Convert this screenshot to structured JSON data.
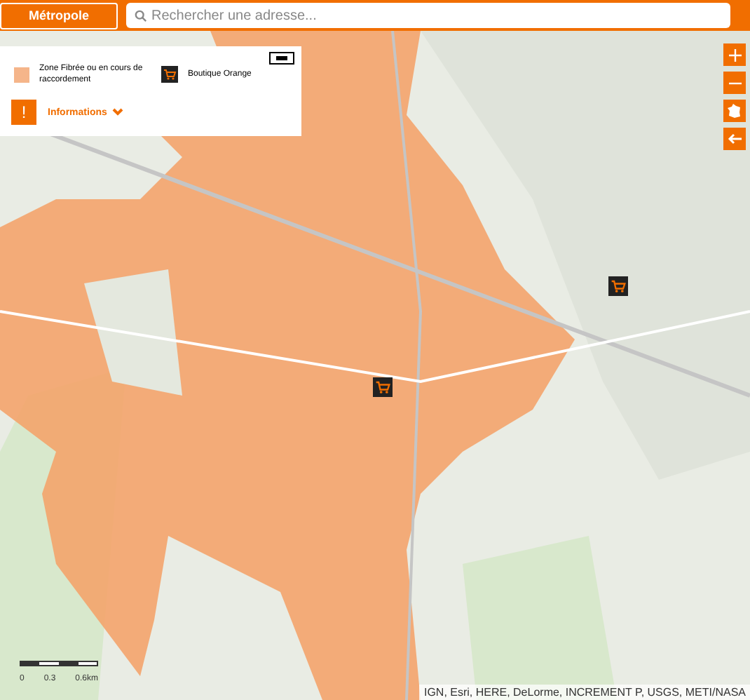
{
  "header": {
    "region_button": "Métropole",
    "search": {
      "placeholder": "Rechercher une adresse..."
    }
  },
  "legend": {
    "items": [
      {
        "kind": "swatch",
        "label": "Zone Fibrée ou en cours de raccordement",
        "color": "#f5b58a"
      },
      {
        "kind": "shop",
        "label": "Boutique Orange"
      }
    ],
    "info": {
      "icon": "!",
      "label": "Informations"
    }
  },
  "scale": {
    "ticks": [
      "0",
      "0.3",
      "0.6km"
    ]
  },
  "attribution": "IGN, Esri, HERE, DeLorme, INCREMENT P, USGS, METI/NASA"
}
